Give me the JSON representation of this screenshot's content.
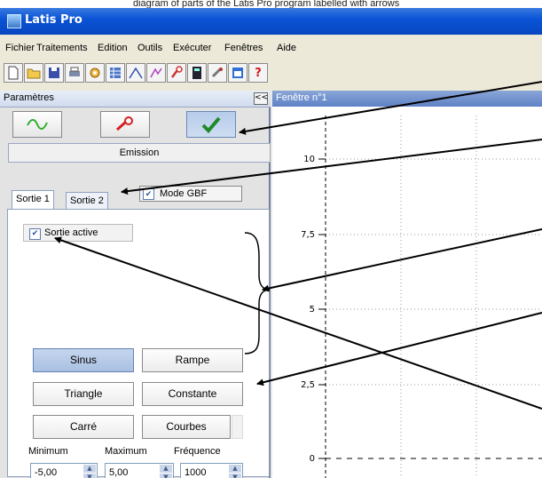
{
  "caption": "diagram of parts of the Latis Pro program labelled with arrows",
  "app": {
    "title": "Latis Pro"
  },
  "menu": [
    "Fichier",
    "Traitements",
    "Edition",
    "Outils",
    "Exécuter",
    "Fenêtres",
    "Aide"
  ],
  "toolbar_icons": [
    "new-file-icon",
    "open-folder-icon",
    "save-icon",
    "print-icon",
    "camera-icon",
    "table-icon",
    "curve-icon",
    "tool-icon",
    "generator-icon",
    "calculator-icon",
    "tool-box-icon",
    "window-icon",
    "help-icon"
  ],
  "panel": {
    "title": "Paramètres",
    "collapse": "<<",
    "emission": "Emission",
    "tabs": [
      "Sortie 1",
      "Sortie 2"
    ],
    "mode_gbf": "Mode GBF",
    "sortie_active": "Sortie active",
    "waveforms": [
      "Sinus",
      "Rampe",
      "Triangle",
      "Constante",
      "Carré",
      "Courbes"
    ],
    "params": {
      "minimum": {
        "label": "Minimum",
        "value": "-5,00"
      },
      "maximum": {
        "label": "Maximum",
        "value": "5,00"
      },
      "frequence": {
        "label": "Fréquence",
        "value": "1000"
      }
    }
  },
  "graph": {
    "title": "Fenêtre n°1",
    "y_ticks": [
      "10",
      "7,5",
      "5",
      "2,5",
      "0"
    ]
  },
  "colors": {
    "titlebar": "#0a54d6",
    "panel_border": "#6d7fae",
    "selected_button": "#a9c0e2",
    "arrow": "#000000"
  }
}
